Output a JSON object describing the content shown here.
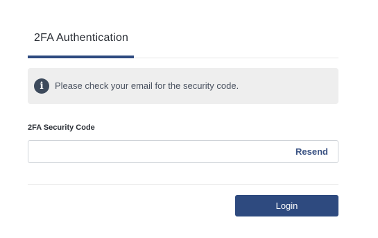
{
  "tabs": {
    "active_label": "2FA Authentication",
    "accent_color": "#2e4a7f"
  },
  "alert": {
    "icon": "info-icon",
    "icon_glyph": "i",
    "message": "Please check your email for the security code."
  },
  "form": {
    "code_label": "2FA Security Code",
    "code_value": "",
    "code_placeholder": "",
    "resend_label": "Resend",
    "login_label": "Login"
  }
}
